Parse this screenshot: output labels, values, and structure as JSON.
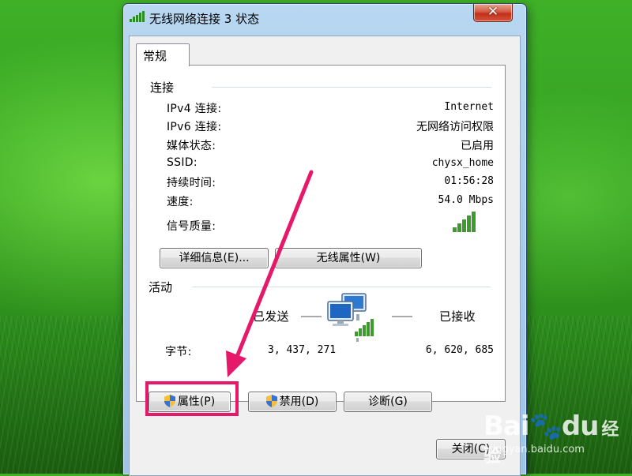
{
  "window": {
    "title": "无线网络连接 3 状态",
    "close_glyph": "✕"
  },
  "tabs": [
    {
      "label": "常规",
      "selected": true
    }
  ],
  "connection": {
    "heading": "连接",
    "rows": [
      {
        "label": "IPv4 连接:",
        "value": "Internet"
      },
      {
        "label": "IPv6 连接:",
        "value": "无网络访问权限"
      },
      {
        "label": "媒体状态:",
        "value": "已启用"
      },
      {
        "label": "SSID:",
        "value": "chysx_home"
      },
      {
        "label": "持续时间:",
        "value": "01:56:28"
      },
      {
        "label": "速度:",
        "value": "54.0 Mbps"
      }
    ],
    "signal_label": "信号质量:",
    "signal_bars": 5,
    "details_button": "详细信息(E)...",
    "wireless_props_button": "无线属性(W)"
  },
  "activity": {
    "heading": "活动",
    "sent_label": "已发送",
    "received_label": "已接收",
    "bytes_label": "字节:",
    "bytes_sent": "3, 437, 271",
    "bytes_received": "6, 620, 685"
  },
  "actions": {
    "properties_button": "属性(P)",
    "disable_button": "禁用(D)",
    "diagnose_button": "诊断(G)",
    "close_button": "关闭(C)"
  },
  "annotation_color": "#e6186a",
  "watermark": {
    "brand": "Bai",
    "paw": "🐾",
    "brand2": "du",
    "jingyan": "经验",
    "url": "jingyan.baidu.com"
  }
}
